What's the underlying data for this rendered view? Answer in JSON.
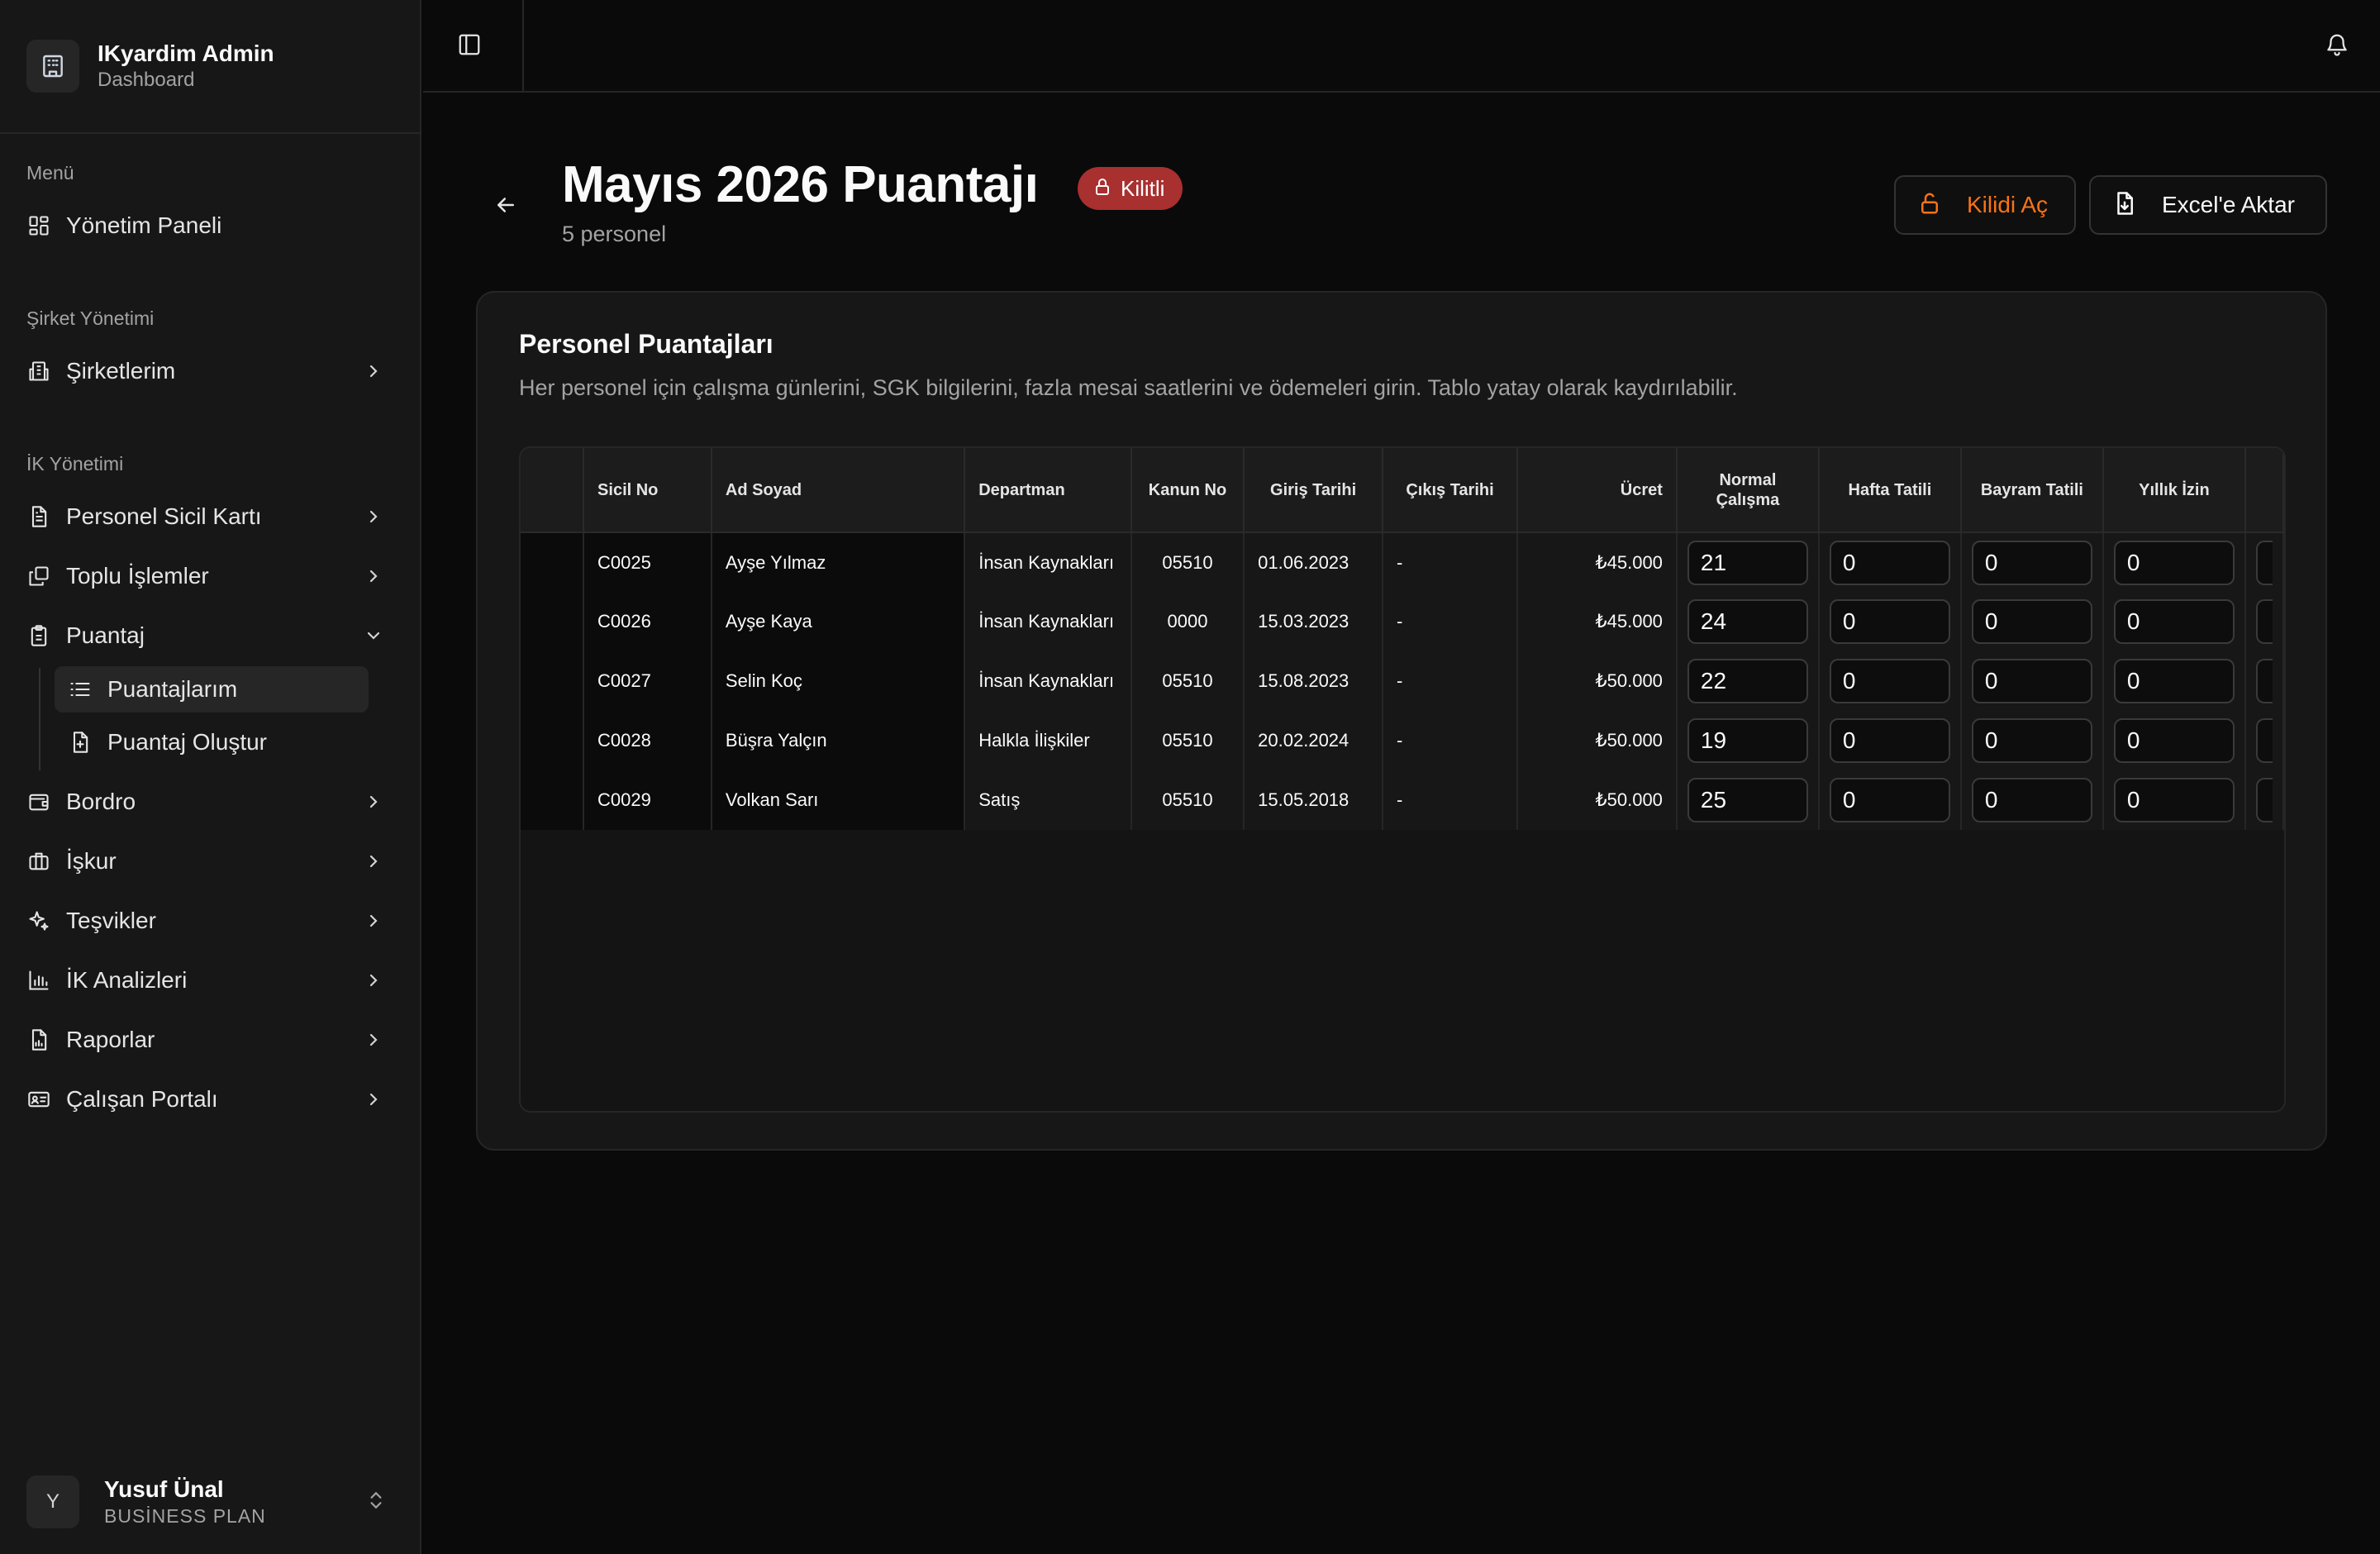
{
  "brand": {
    "title": "IKyardim Admin",
    "subtitle": "Dashboard"
  },
  "nav": {
    "menu_label": "Menü",
    "dashboard": "Yönetim Paneli",
    "company_label": "Şirket Yönetimi",
    "companies": "Şirketlerim",
    "hr_label": "İK Yönetimi",
    "personnel": "Personel Sicil Kartı",
    "bulk": "Toplu İşlemler",
    "timesheet": "Puantaj",
    "my_timesheets": "Puantajlarım",
    "create_timesheet": "Puantaj Oluştur",
    "payroll": "Bordro",
    "iskur": "İşkur",
    "incentives": "Teşvikler",
    "analytics": "İK Analizleri",
    "reports": "Raporlar",
    "portal": "Çalışan Portalı"
  },
  "user": {
    "initial": "Y",
    "name": "Yusuf Ünal",
    "plan": "BUSİNESS PLAN"
  },
  "header": {
    "title": "Mayıs 2026 Puantajı",
    "badge": "Kilitli",
    "subtitle": "5 personel",
    "unlock_label": "Kilidi Aç",
    "export_label": "Excel'e Aktar"
  },
  "card": {
    "title": "Personel Puantajları",
    "description": "Her personel için çalışma günlerini, SGK bilgilerini, fazla mesai saatlerini ve ödemeleri girin. Tablo yatay olarak kaydırılabilir."
  },
  "table": {
    "columns": {
      "sicil": "Sicil No",
      "name": "Ad Soyad",
      "dept": "Departman",
      "kanun": "Kanun No",
      "giris": "Giriş Tarihi",
      "cikis": "Çıkış Tarihi",
      "ucret": "Ücret",
      "normal_1": "Normal",
      "normal_2": "Çalışma",
      "hafta": "Hafta Tatili",
      "bayram": "Bayram Tatili",
      "yillik": "Yıllık İzin"
    },
    "rows": [
      {
        "sicil": "C0025",
        "name": "Ayşe Yılmaz",
        "dept": "İnsan Kaynakları",
        "kanun": "05510",
        "giris": "01.06.2023",
        "cikis": "-",
        "ucret": "₺45.000",
        "normal": "21",
        "hafta": "0",
        "bayram": "0",
        "yillik": "0"
      },
      {
        "sicil": "C0026",
        "name": "Ayşe Kaya",
        "dept": "İnsan Kaynakları",
        "kanun": "0000",
        "giris": "15.03.2023",
        "cikis": "-",
        "ucret": "₺45.000",
        "normal": "24",
        "hafta": "0",
        "bayram": "0",
        "yillik": "0"
      },
      {
        "sicil": "C0027",
        "name": "Selin Koç",
        "dept": "İnsan Kaynakları",
        "kanun": "05510",
        "giris": "15.08.2023",
        "cikis": "-",
        "ucret": "₺50.000",
        "normal": "22",
        "hafta": "0",
        "bayram": "0",
        "yillik": "0"
      },
      {
        "sicil": "C0028",
        "name": "Büşra Yalçın",
        "dept": "Halkla İlişkiler",
        "kanun": "05510",
        "giris": "20.02.2024",
        "cikis": "-",
        "ucret": "₺50.000",
        "normal": "19",
        "hafta": "0",
        "bayram": "0",
        "yillik": "0"
      },
      {
        "sicil": "C0029",
        "name": "Volkan Sarı",
        "dept": "Satış",
        "kanun": "05510",
        "giris": "15.05.2018",
        "cikis": "-",
        "ucret": "₺50.000",
        "normal": "25",
        "hafta": "0",
        "bayram": "0",
        "yillik": "0"
      }
    ]
  },
  "colors": {
    "accent_orange": "#f97316",
    "badge_red": "#a8302f",
    "background": "#0a0a0a",
    "surface": "#171717"
  }
}
